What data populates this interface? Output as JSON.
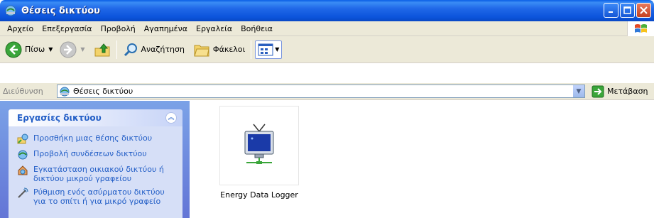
{
  "window": {
    "title": "Θέσεις δικτύου"
  },
  "menu": {
    "items": [
      "Αρχείο",
      "Επεξεργασία",
      "Προβολή",
      "Αγαπημένα",
      "Εργαλεία",
      "Βοήθεια"
    ]
  },
  "toolbar": {
    "back_label": "Πίσω",
    "search_label": "Αναζήτηση",
    "folders_label": "Φάκελοι"
  },
  "address": {
    "label": "Διεύθυνση",
    "value": "Θέσεις δικτύου",
    "go_label": "Μετάβαση"
  },
  "taskpane": {
    "header": "Εργασίες δικτύου",
    "items": [
      {
        "label": "Προσθήκη μιας θέσης δικτύου",
        "icon": "add-network-place-icon"
      },
      {
        "label": "Προβολή συνδέσεων δικτύου",
        "icon": "network-connections-icon"
      },
      {
        "label": "Εγκατάσταση οικιακού δικτύου ή δικτύου μικρού γραφείου",
        "icon": "home-network-icon"
      },
      {
        "label": "Ρύθμιση ενός ασύρματου δικτύου για το σπίτι ή για μικρό γραφείο",
        "icon": "wireless-network-icon"
      }
    ]
  },
  "content": {
    "items": [
      {
        "label": "Energy Data Logger",
        "icon": "network-computer-icon"
      }
    ]
  },
  "colors": {
    "title_bar": "#0c54dc",
    "task_pane": "#6f8cdf",
    "task_link": "#215dc6"
  }
}
